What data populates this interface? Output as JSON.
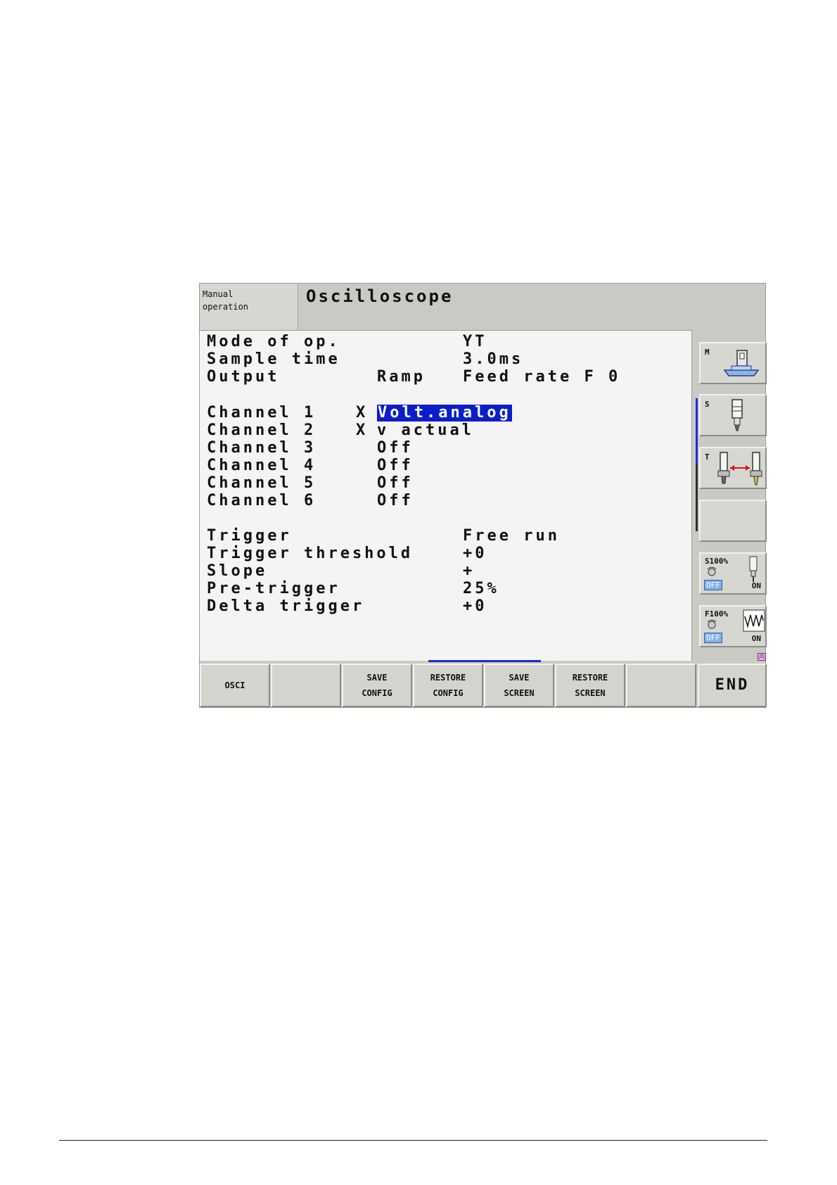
{
  "header": {
    "mode_line1": "Manual",
    "mode_line2": "operation",
    "title": "Oscilloscope"
  },
  "settings": {
    "mode_label": "Mode of op.",
    "mode_value": "YT",
    "sample_label": "Sample time",
    "sample_value": "3.0ms",
    "output_label": "Output",
    "output_col2": "Ramp",
    "output_value": "Feed rate F 0"
  },
  "channels": [
    {
      "label": "Channel 1",
      "marker": "X",
      "value": "Volt.analog",
      "selected": true
    },
    {
      "label": "Channel 2",
      "marker": "X",
      "value": "v actual"
    },
    {
      "label": "Channel 3",
      "marker": "",
      "value": "Off"
    },
    {
      "label": "Channel 4",
      "marker": "",
      "value": "Off"
    },
    {
      "label": "Channel 5",
      "marker": "",
      "value": "Off"
    },
    {
      "label": "Channel 6",
      "marker": "",
      "value": "Off"
    }
  ],
  "trigger": {
    "trigger_label": "Trigger",
    "trigger_value": "Free run",
    "threshold_label": "Trigger threshold",
    "threshold_value": "+0",
    "slope_label": "Slope",
    "slope_value": "+",
    "pre_label": "Pre-trigger",
    "pre_value": "25%",
    "delta_label": "Delta trigger",
    "delta_value": "+0"
  },
  "side": {
    "m_label": "M",
    "s_label": "S",
    "t_label": "T",
    "s_override": "S100%",
    "f_override": "F100%",
    "off": "OFF",
    "on": "ON"
  },
  "softkeys": [
    {
      "line1": "OSCI",
      "line2": ""
    },
    {
      "line1": "",
      "line2": ""
    },
    {
      "line1": "SAVE",
      "line2": "CONFIG"
    },
    {
      "line1": "RESTORE",
      "line2": "CONFIG"
    },
    {
      "line1": "SAVE",
      "line2": "SCREEN"
    },
    {
      "line1": "RESTORE",
      "line2": "SCREEN"
    },
    {
      "line1": "",
      "line2": ""
    },
    {
      "line1": "END",
      "line2": ""
    }
  ],
  "colors": {
    "highlight": "#0b1ec8",
    "panel": "#f4f4f4",
    "frame": "#c9cac4"
  }
}
